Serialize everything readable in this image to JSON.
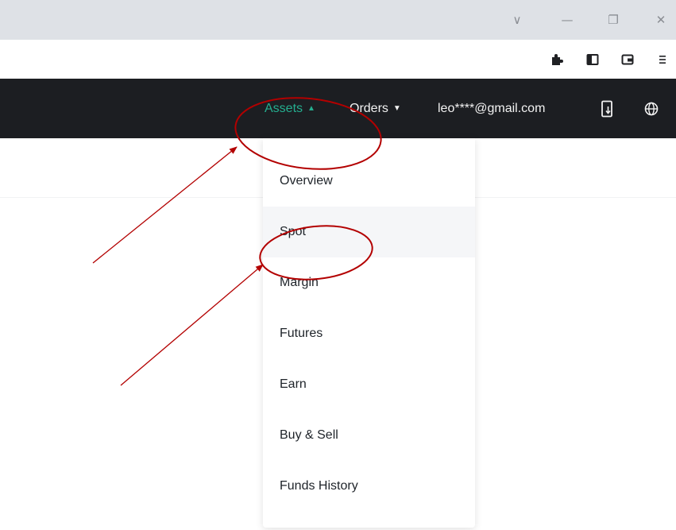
{
  "window_controls": [
    {
      "name": "dropdown-icon",
      "glyph": "∨"
    },
    {
      "name": "minimize-icon",
      "glyph": "—"
    },
    {
      "name": "restore-icon",
      "glyph": "❐"
    },
    {
      "name": "close-icon",
      "glyph": "✕"
    }
  ],
  "toolbar_icons": [
    "extensions-icon",
    "sidebar-icon",
    "wallet-icon",
    "menu-icon"
  ],
  "nav": {
    "assets_label": "Assets",
    "orders_label": "Orders",
    "account_email": "leo****@gmail.com",
    "accent_color": "#24ae8f",
    "background_color": "#1c1e22"
  },
  "assets_menu": [
    {
      "label": "Overview",
      "hovered": false
    },
    {
      "label": "Spot",
      "hovered": true
    },
    {
      "label": "Margin",
      "hovered": false
    },
    {
      "label": "Futures",
      "hovered": false
    },
    {
      "label": "Earn",
      "hovered": false
    },
    {
      "label": "Buy & Sell",
      "hovered": false
    },
    {
      "label": "Funds History",
      "hovered": false
    }
  ],
  "annotation_color": "#b30000"
}
